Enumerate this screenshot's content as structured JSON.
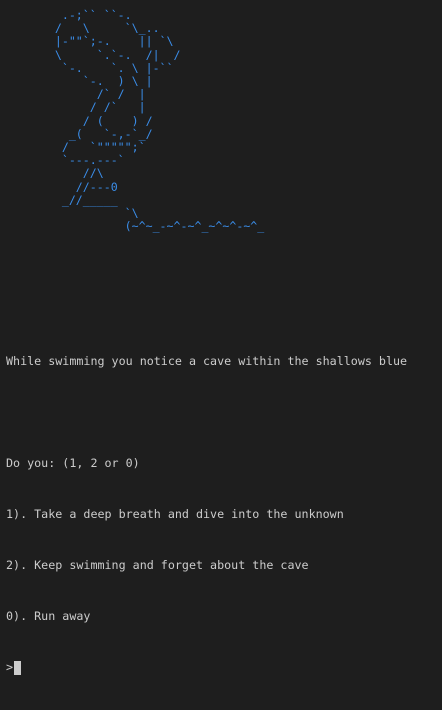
{
  "colors": {
    "background": "#1e1e1e",
    "text": "#cccccc",
    "art": "#3b8eea"
  },
  "art": {
    "lines": [
      "        .-;`` ``-.",
      "       /   \\     `\\_..",
      "       |-\"\"`;-.    || `\\",
      "       \\     `.`-.  /|  /",
      "        `-.    `. \\ |-``",
      "           `-.  ) \\ |",
      "             /` /  |",
      "            / /`   |",
      "           / (    ) /",
      "         _(   `-,-`_/",
      "        /   `\"\"\"\"\";`",
      "        `---.---`",
      "           //\\",
      "          //---0",
      "        _//_____",
      "                 `\\",
      "                 (~^~_-~^-~^_~^~^-~^_"
    ]
  },
  "story": {
    "narration": "While swimming you notice a cave within the shallows blue",
    "question": "Do you: (1, 2 or 0)",
    "options": [
      "1). Take a deep breath and dive into the unknown",
      "2). Keep swimming and forget about the cave",
      "0). Run away"
    ]
  },
  "prompt": {
    "symbol": ">"
  }
}
